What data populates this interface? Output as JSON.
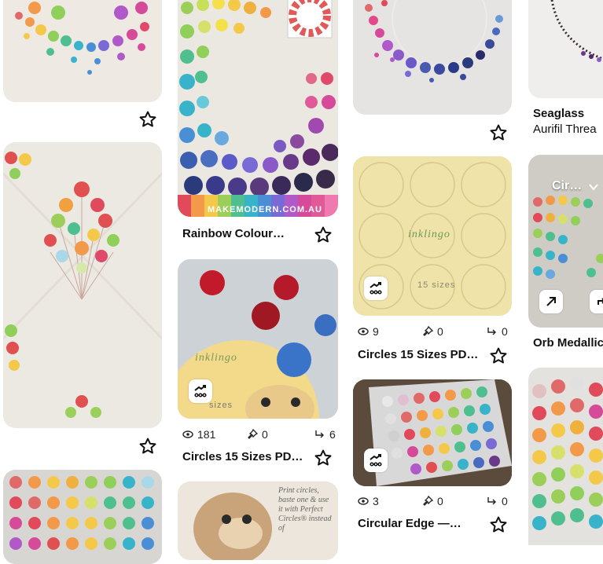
{
  "pins": {
    "col1_top": {
      "alt": ""
    },
    "col2_rainbow": {
      "title": "Rainbow Colour…",
      "watermark": "MAKEMODERN.COM.AU"
    },
    "col2_circles": {
      "title": "Circles 15 Sizes PD…",
      "views": "181",
      "saves": "0",
      "repins": "6",
      "sizes_text": "sizes"
    },
    "col3_circles": {
      "title": "Circles 15 Sizes PD…",
      "views": "9",
      "saves": "0",
      "repins": "0",
      "sizes_text": "15 sizes"
    },
    "col3_edge": {
      "title": "Circular Edge —…",
      "views": "3",
      "saves": "0",
      "repins": "0"
    },
    "col4_seaglass": {
      "title": "Seaglass",
      "subtitle": "Aurifil Threa"
    },
    "col4_orb": {
      "title": "Orb Medallic",
      "overlay": "Cir…"
    },
    "col2_monkey": {
      "overlay_text": "Print circles, baste one & use it with Perfect Circles® instead of"
    }
  },
  "watermark_ink": "inklingo",
  "colors": {
    "accent": "#111111",
    "card_bg": "#f3f1ec"
  },
  "icons": {
    "star": "star-outline-icon",
    "views": "eye-icon",
    "saves": "pin-icon",
    "repins": "repin-icon",
    "analytics": "analytics-icon",
    "arrow": "arrow-up-right-icon",
    "chevron": "chevron-down-icon"
  }
}
